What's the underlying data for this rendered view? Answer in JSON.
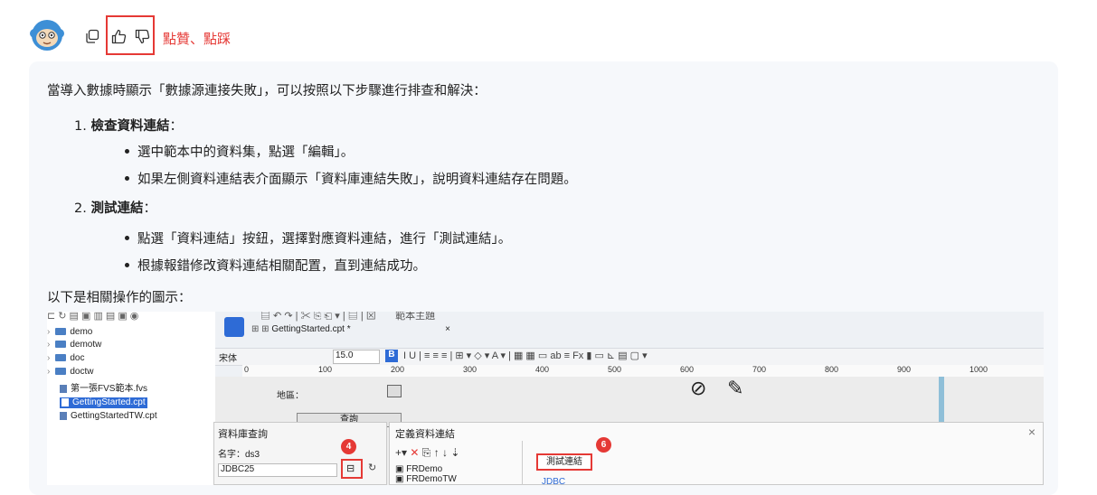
{
  "header": {
    "avatar_icon": "monkey-avatar-icon",
    "copy_icon": "copy-icon",
    "like_icon": "thumbs-up-icon",
    "dislike_icon": "thumbs-down-icon",
    "vote_label": "點贊、點踩",
    "highlight_color": "#e53935"
  },
  "answer": {
    "intro": "當導入數據時顯示「數據源連接失敗」，可以按照以下步驟進行排查和解決：",
    "steps": [
      {
        "num": "1.",
        "title": "檢查資料連結",
        "colon": "：",
        "bullets": [
          "選中範本中的資料集，點選「編輯」。",
          "如果左側資料連結表介面顯示「資料庫連結失敗」，說明資料連結存在問題。"
        ]
      },
      {
        "num": "2.",
        "title": "測試連結",
        "colon": "：",
        "bullets": [
          "點選「資料連結」按鈕，選擇對應資料連結，進行「測試連結」。",
          "根據報錯修改資料連結相關配置，直到連結成功。"
        ]
      }
    ],
    "footer": "以下是相關操作的圖示："
  },
  "screenshot": {
    "tree": {
      "items": [
        "demo",
        "demotw",
        "doc",
        "doctw",
        "第一張FVS範本.fvs",
        "GettingStarted.cpt",
        "GettingStartedTW.cpt"
      ],
      "selected": "GettingStarted.cpt"
    },
    "toolbar": {
      "theme_label": "範本主題"
    },
    "tab": {
      "title": "GettingStarted.cpt *",
      "close": "×"
    },
    "format": {
      "font": "宋体",
      "size": "15.0"
    },
    "ruler": [
      "0",
      "100",
      "200",
      "300",
      "400",
      "500",
      "600",
      "700",
      "800",
      "900",
      "1000"
    ],
    "canvas": {
      "region_label": "地區：",
      "query_button": "查詢"
    },
    "query_dialog": {
      "title": "資料庫查詢",
      "name_label": "名字：",
      "name_value": "ds3",
      "connection": "JDBC25",
      "step_badge": "4"
    },
    "connection_dialog": {
      "title": "定義資料連結",
      "close": "×",
      "list": [
        "FRDemo",
        "FRDemoTW"
      ],
      "test_button": "測試連結",
      "type_label": "JDBC",
      "step_badge": "6"
    }
  }
}
